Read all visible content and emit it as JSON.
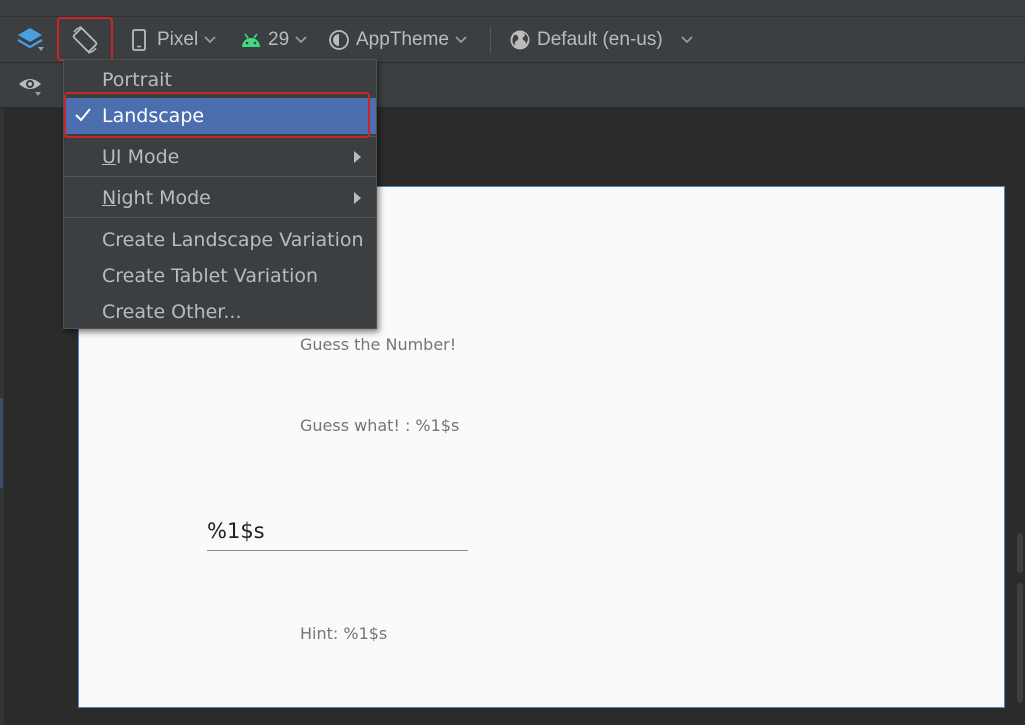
{
  "toolbar": {
    "device": "Pixel",
    "api_level": "29",
    "theme": "AppTheme",
    "locale": "Default (en-us)",
    "icons": [
      "layers-icon",
      "orientation-icon",
      "phone-icon",
      "android-icon",
      "theme-icon",
      "globe-icon",
      "eye-icon"
    ]
  },
  "orientation_menu": {
    "items": [
      {
        "label": "Portrait",
        "selected": false
      },
      {
        "label": "Landscape",
        "selected": true
      },
      {
        "label": "UI Mode",
        "mnemonic": "U",
        "submenu": true
      },
      {
        "label": "Night Mode",
        "mnemonic": "N",
        "submenu": true
      },
      {
        "label": "Create Landscape Variation"
      },
      {
        "label": "Create Tablet Variation"
      },
      {
        "label": "Create Other..."
      }
    ]
  },
  "preview": {
    "title_text": "Guess the Number!",
    "guess_text": "Guess what! : %1$s",
    "input_value": "%1$s",
    "hint_text": "Hint: %1$s"
  },
  "colors": {
    "highlight": "#4b6eaf",
    "annotation_red": "#c8262a",
    "android_green": "#3ddc84",
    "layers_blue": "#4a9fe0"
  }
}
